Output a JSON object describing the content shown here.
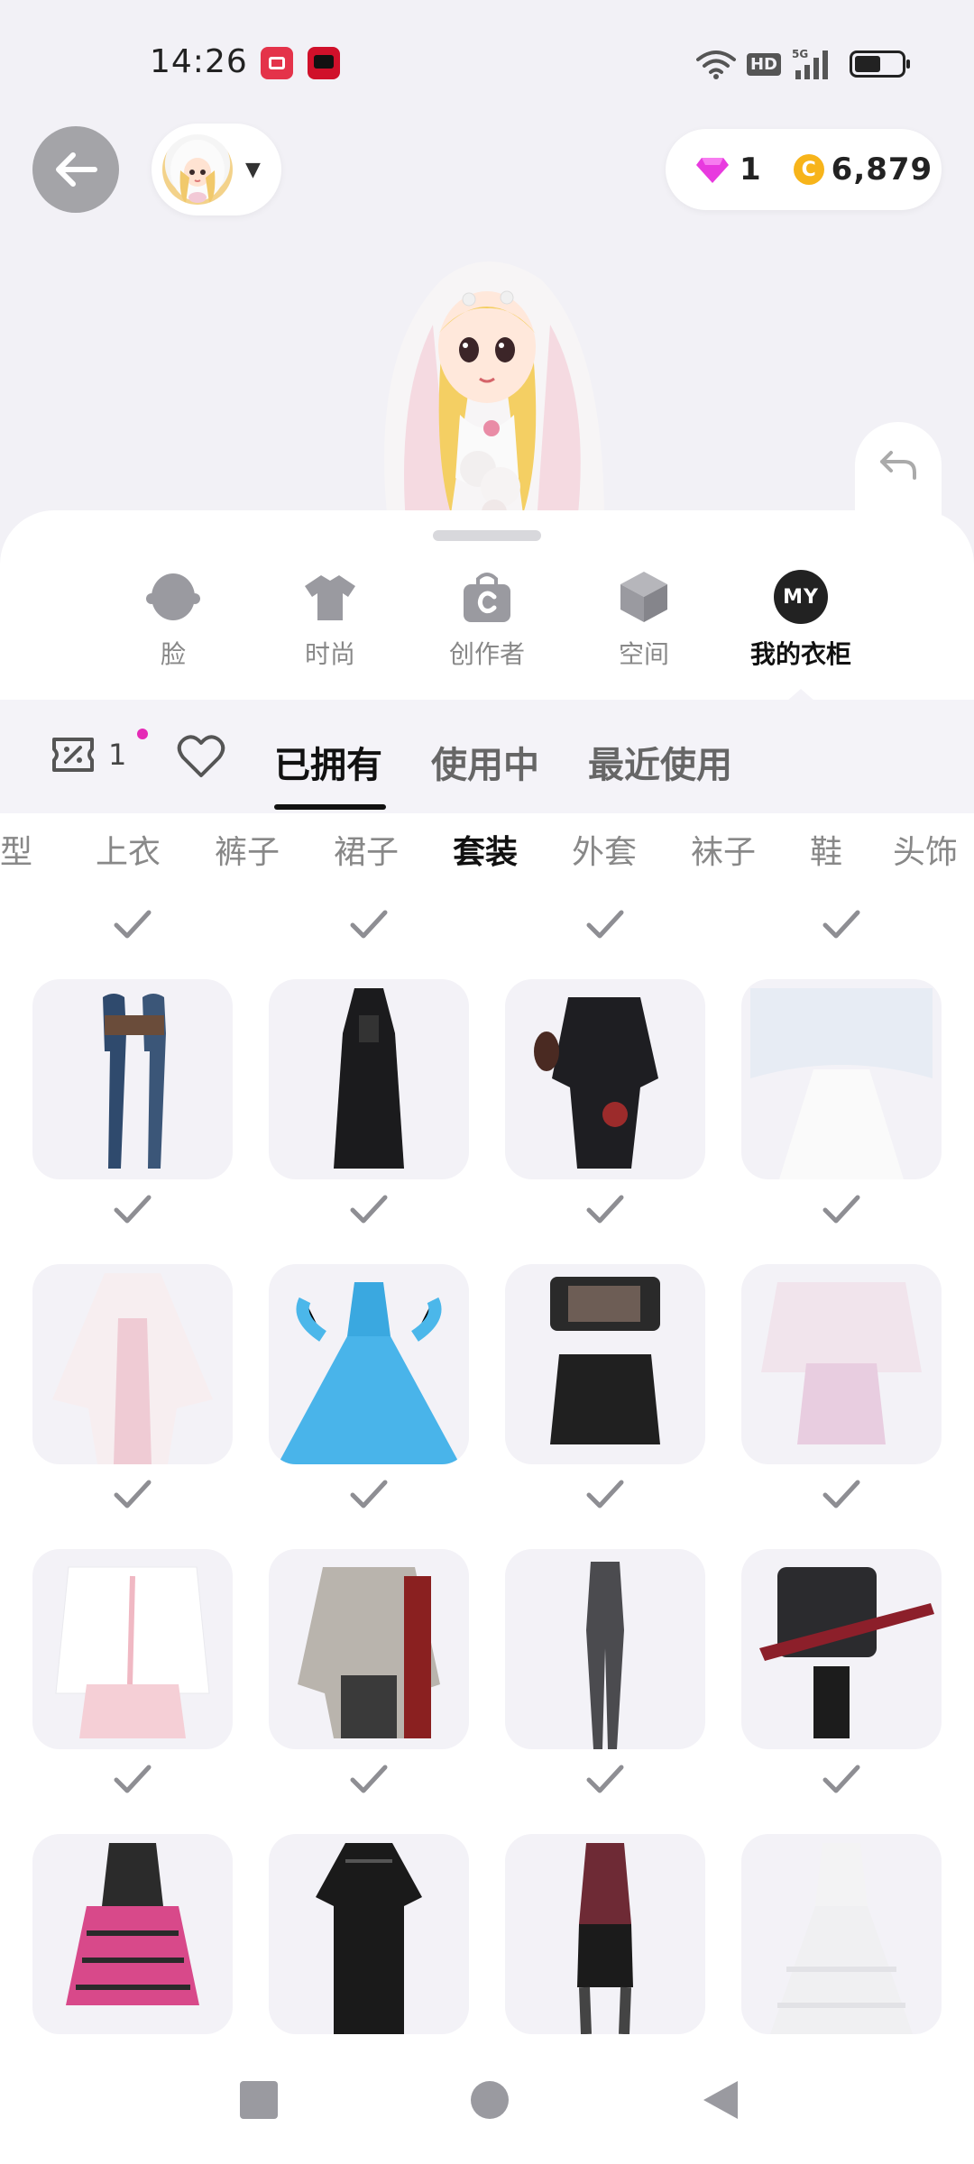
{
  "status_bar": {
    "time": "14:26",
    "network_badge": "HD",
    "signal_label": "5G",
    "icons": [
      "screen-recorder-icon",
      "video-app-icon",
      "wifi-icon",
      "hd-icon",
      "signal-icon",
      "battery-icon"
    ]
  },
  "header": {
    "back_icon": "arrow-left-icon",
    "gem_count": "1",
    "coin_symbol": "C",
    "coin_count": "6,879"
  },
  "category_tabs": [
    {
      "label": "脸",
      "icon": "face-icon",
      "active": false
    },
    {
      "label": "时尚",
      "icon": "tshirt-icon",
      "active": false
    },
    {
      "label": "创作者",
      "icon": "creator-bag-icon",
      "active": false
    },
    {
      "label": "空间",
      "icon": "cube-icon",
      "active": false
    },
    {
      "label": "我的衣柜",
      "icon": "my-wardrobe-icon",
      "badge": "MY",
      "active": true
    }
  ],
  "filter_bar": {
    "coupon_count": "1",
    "tabs": [
      {
        "label": "已拥有",
        "active": true
      },
      {
        "label": "使用中",
        "active": false
      },
      {
        "label": "最近使用",
        "active": false
      }
    ]
  },
  "sub_tabs": [
    {
      "label": "发型",
      "active": false
    },
    {
      "label": "上衣",
      "active": false
    },
    {
      "label": "裤子",
      "active": false
    },
    {
      "label": "裙子",
      "active": false
    },
    {
      "label": "套装",
      "active": true
    },
    {
      "label": "外套",
      "active": false
    },
    {
      "label": "袜子",
      "active": false
    },
    {
      "label": "鞋",
      "active": false
    },
    {
      "label": "头饰",
      "active": false
    }
  ],
  "outfits": [
    {
      "name": "denim-flare-jeans-outfit",
      "owned": true
    },
    {
      "name": "black-gothic-dress-outfit",
      "owned": true
    },
    {
      "name": "black-kimono-fan-outfit",
      "owned": true
    },
    {
      "name": "white-lace-veil-gown-outfit",
      "owned": true
    },
    {
      "name": "pink-white-hanfu-outfit",
      "owned": true
    },
    {
      "name": "blue-ball-gown-outfit",
      "owned": true
    },
    {
      "name": "black-crop-skirt-outfit",
      "owned": true
    },
    {
      "name": "pink-fluffy-dress-outfit",
      "owned": true
    },
    {
      "name": "white-bunny-hoodie-outfit",
      "owned": true
    },
    {
      "name": "patchwork-knit-outfit",
      "owned": true
    },
    {
      "name": "grey-flare-pants-outfit",
      "owned": true
    },
    {
      "name": "guitar-rocker-outfit",
      "owned": true
    },
    {
      "name": "pink-plaid-punk-outfit",
      "owned": true
    },
    {
      "name": "black-lace-qipao-outfit",
      "owned": true
    },
    {
      "name": "burgundy-top-skirt-outfit",
      "owned": true
    },
    {
      "name": "white-ruffle-gown-outfit",
      "owned": true
    }
  ],
  "nav_bar": {
    "recents_icon": "square-recents-icon",
    "home_icon": "circle-home-icon",
    "back_icon": "triangle-back-icon"
  },
  "colors": {
    "background": "#f2f1f6",
    "accent_dot": "#e52ab6",
    "gem": "#e83adf",
    "coin": "#f7b41a"
  }
}
